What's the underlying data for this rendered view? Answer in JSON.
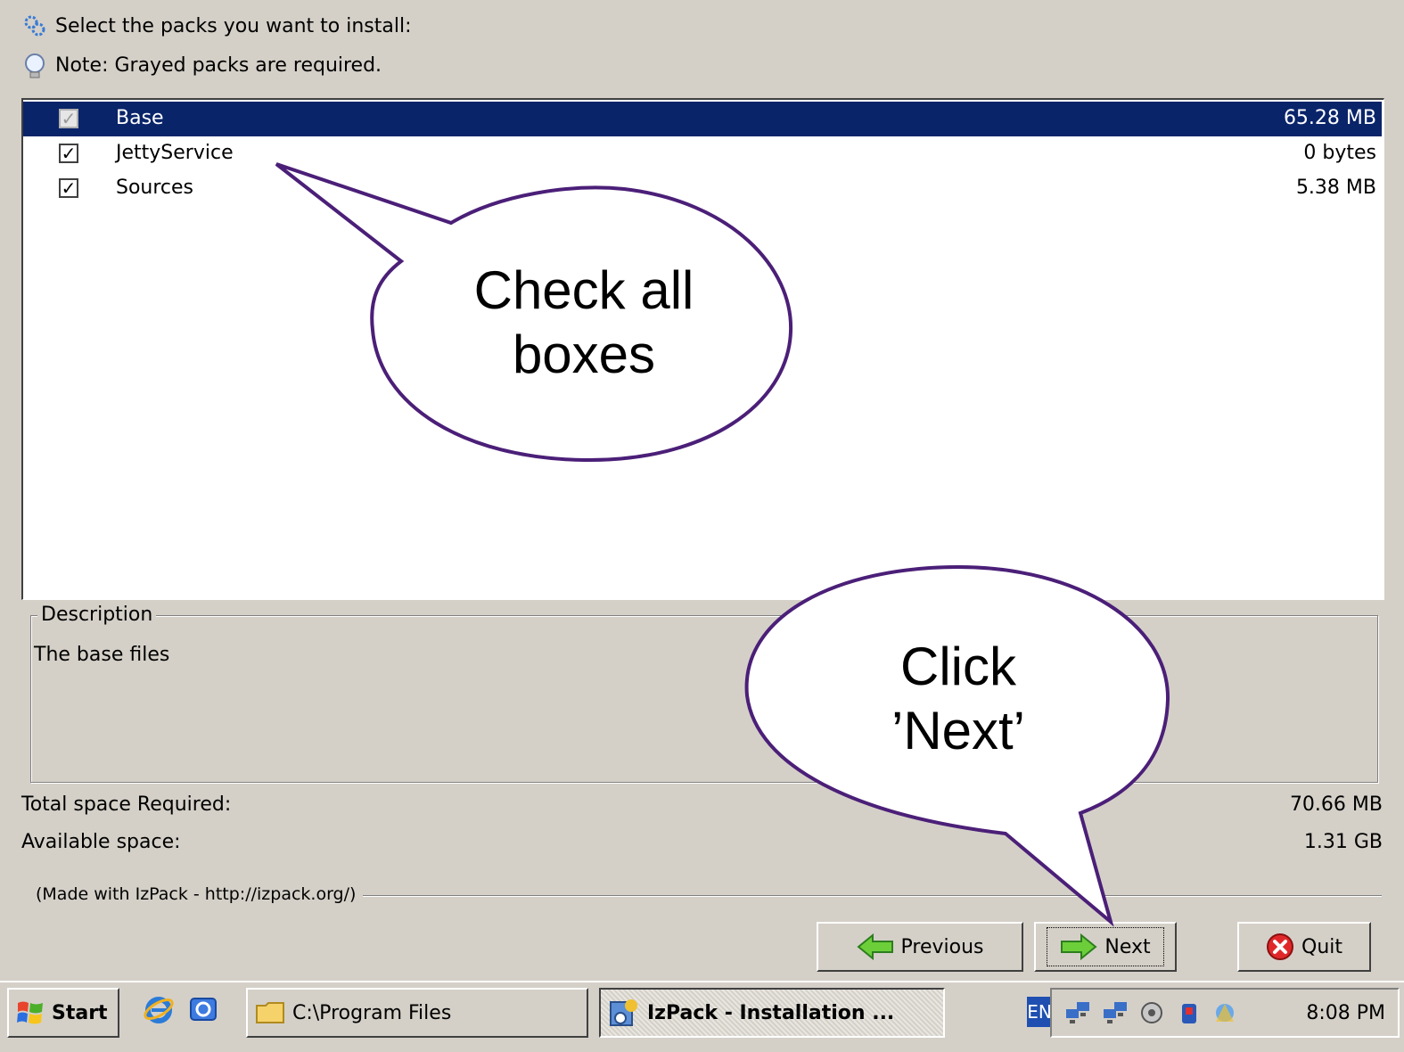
{
  "header": {
    "select_text": "Select the packs you want to install:",
    "note_text": "Note: Grayed packs are required."
  },
  "packs": [
    {
      "name": "Base",
      "size": "65.28 MB",
      "checked": true,
      "required": true,
      "selected": true
    },
    {
      "name": "JettyService",
      "size": "0 bytes",
      "checked": true,
      "required": false,
      "selected": false
    },
    {
      "name": "Sources",
      "size": "5.38 MB",
      "checked": true,
      "required": false,
      "selected": false
    }
  ],
  "description": {
    "title": "Description",
    "text": "The base files"
  },
  "space": {
    "total_label": "Total space Required:",
    "total_value": "70.66 MB",
    "available_label": "Available space:",
    "available_value": "1.31 GB"
  },
  "made_with": "(Made with IzPack - http://izpack.org/)",
  "buttons": {
    "previous": "Previous",
    "next": "Next",
    "quit": "Quit"
  },
  "taskbar": {
    "start": "Start",
    "task1": "C:\\Program Files",
    "task2": "IzPack - Installation ...",
    "lang": "EN",
    "clock": "8:08 PM"
  },
  "callouts": {
    "check_line1": "Check all",
    "check_line2": "boxes",
    "click_line1": "Click",
    "click_line2": "’Next’"
  }
}
